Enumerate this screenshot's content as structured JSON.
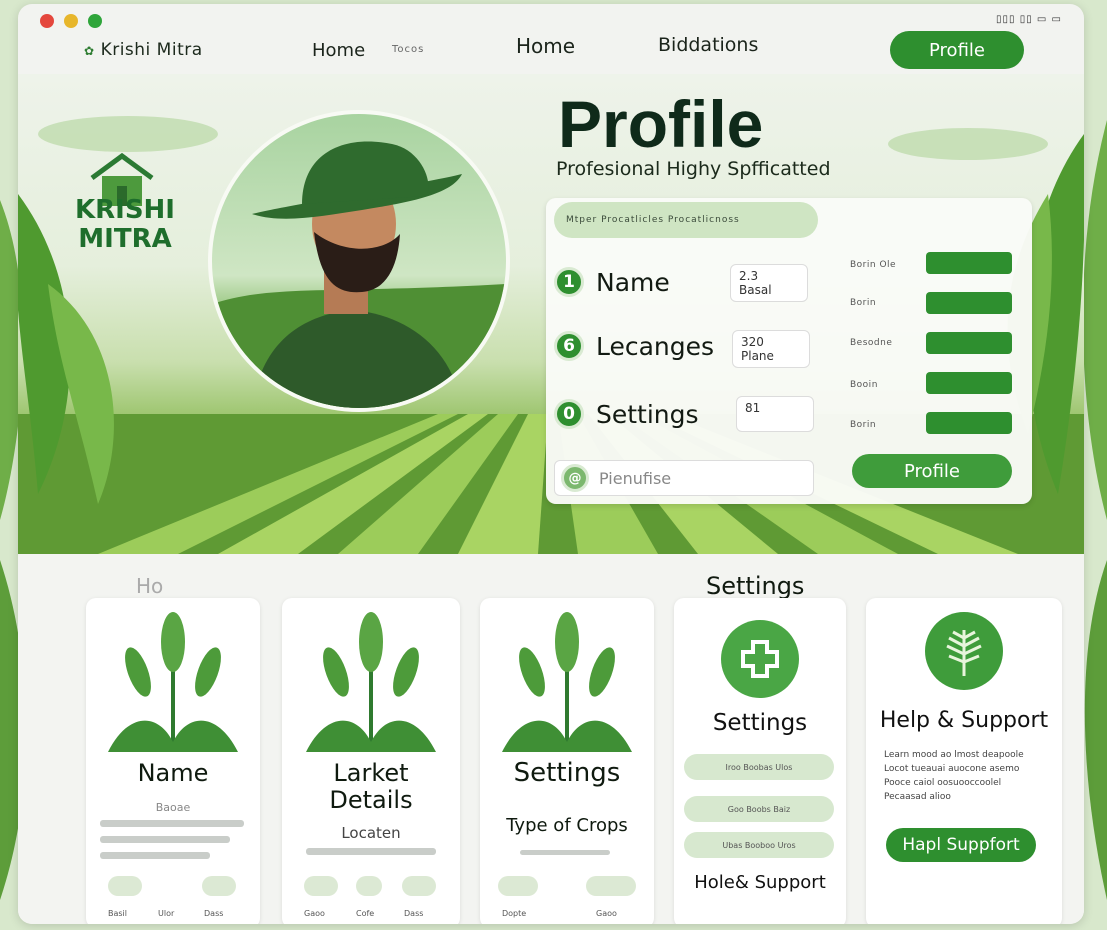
{
  "window": {
    "brand": "Krishi  Mitra",
    "sys_icons": "▯▯▯ ▯▯ ▭ ▭"
  },
  "nav": {
    "item1": "Home",
    "item1_sub": "Tocos",
    "item2": "Home",
    "item3": "Biddations",
    "profile_button": "Profile"
  },
  "hero": {
    "logo_text": "KRISHI MITRA",
    "title": "Profile",
    "subtitle": "Profesional Highy Spfficatted"
  },
  "panel": {
    "bar_text": "Mtper Procatlicles          Procatlicnoss",
    "rows": [
      {
        "num": "1",
        "label": "Name",
        "box": "2.3\nBasal"
      },
      {
        "num": "6",
        "label": "Lecanges",
        "box": "320\nPlane"
      },
      {
        "num": "0",
        "label": "Settings",
        "box": "81"
      }
    ],
    "right_labels": [
      "Borin  Ole",
      "Borin",
      "Besodne",
      "Booin",
      "Borin"
    ],
    "bars": [
      0.98,
      0.98,
      0.98,
      0.98,
      0.98
    ],
    "hint_icon": "@",
    "hint_text": "Pienufise",
    "profile_button": "Profile"
  },
  "bottom": {
    "faded_heading": "Ho",
    "heading": "Settings",
    "cards": [
      {
        "title": "Name",
        "sub": "Baoae",
        "foot": [
          "Basil",
          "Ulor",
          "Dass"
        ]
      },
      {
        "title": "Larket\nDetails",
        "sub": "Locaten",
        "foot": [
          "Gaoo",
          "Cofe",
          "Dass"
        ]
      },
      {
        "title": "Settings",
        "sub": "Type of Crops",
        "foot": [
          "Dopte",
          "Gaoo"
        ]
      }
    ],
    "settings_card": {
      "title": "Settings",
      "pills": [
        "Iroo     Boobas     Ulos",
        "Goo     Boobs     Baiz",
        "Ubas     Booboo     Uros"
      ],
      "footer": "Hole& Support"
    },
    "help_card": {
      "title": "Help & Support",
      "lines": [
        "Learn mood ao lmost deapoole",
        "Locot tueauai auocone asemo",
        "Pooce caiol oosuooccoolel",
        "Pecaasad alioo"
      ],
      "button": "Hapl Suppfort"
    }
  }
}
